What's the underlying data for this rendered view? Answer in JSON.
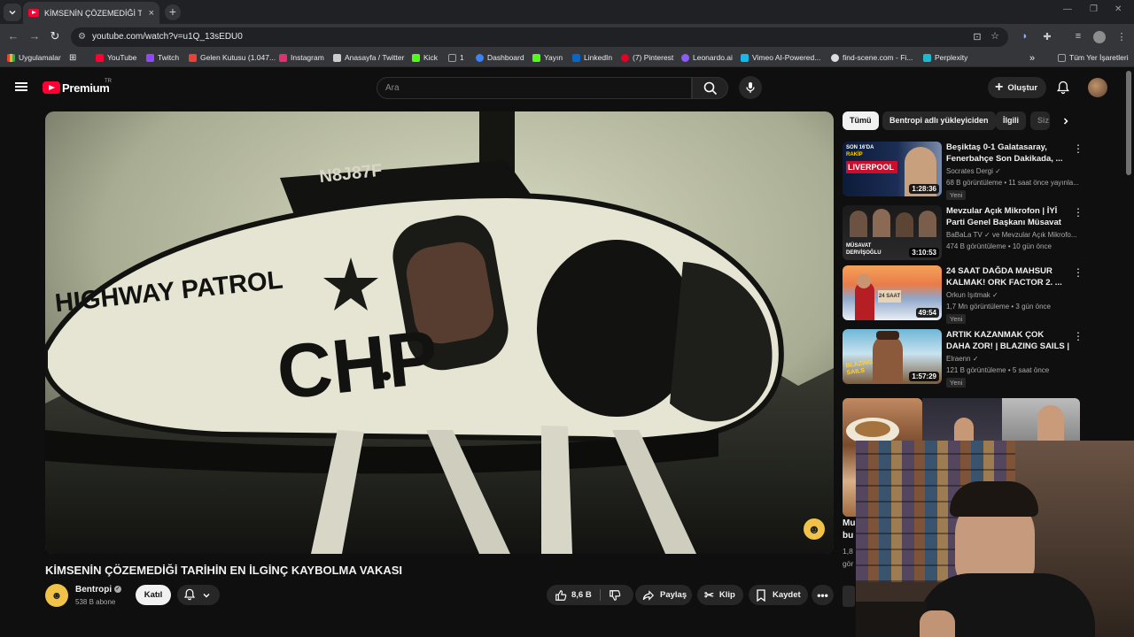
{
  "browser": {
    "tab_title": "KİMSENİN ÇÖZEMEDİĞİ TARİHİN EN İLGİNÇ KAYBOLMA VAKASI",
    "tab_close": "×",
    "new_tab": "+",
    "url": "youtube.com/watch?v=u1Q_13sEDU0"
  },
  "bookmarks": {
    "items": [
      {
        "label": "Uygulamalar",
        "color": "#e37400"
      },
      {
        "label": "YouTube",
        "color": "#ff0033"
      },
      {
        "label": "Twitch",
        "color": "#9146ff"
      },
      {
        "label": "Gelen Kutusu (1.047...",
        "color": "#ea4335"
      },
      {
        "label": "Instagram",
        "color": "#e1306c"
      },
      {
        "label": "Anasayfa / Twitter",
        "color": "#cccccc"
      },
      {
        "label": "Kick",
        "color": "#53fc18"
      },
      {
        "label": "1",
        "color": "#9aa0a6"
      },
      {
        "label": "Dashboard",
        "color": "#3b82f6"
      },
      {
        "label": "Yayın",
        "color": "#53fc18"
      },
      {
        "label": "LinkedIn",
        "color": "#0a66c2"
      },
      {
        "label": "(7) Pinterest",
        "color": "#e60023"
      },
      {
        "label": "Leonardo.ai",
        "color": "#8b5cf6"
      },
      {
        "label": "Vimeo AI-Powered...",
        "color": "#1ab7ea"
      },
      {
        "label": "find-scene.com - Fi...",
        "color": "#dddddd"
      },
      {
        "label": "Perplexity",
        "color": "#20b8cd"
      }
    ],
    "more": "»",
    "all_bookmarks": "Tüm Yer İşaretleri"
  },
  "youtube": {
    "logo": "Premium",
    "country": "TR",
    "search_placeholder": "Ara",
    "create_label": "Oluştur"
  },
  "video": {
    "title": "KİMSENİN ÇÖZEMEDİĞİ TARİHİN EN İLGİNÇ KAYBOLMA VAKASI",
    "frame_text": {
      "tail_number": "N8J87F",
      "patrol": "HIGHWAY PATROL",
      "chp": "CHP"
    },
    "channel": "Bentropi",
    "subscribers": "538 B abone",
    "join_label": "Katıl",
    "likes": "8,6 B",
    "share_label": "Paylaş",
    "clip_label": "Klip",
    "save_label": "Kaydet"
  },
  "chips": [
    "Tümü",
    "Bentropi adlı yükleyiciden",
    "İlgili",
    "Siz"
  ],
  "recommendations": [
    {
      "title": "Beşiktaş 0-1 Galatasaray, Fenerbahçe Son Dakikada, ...",
      "channel": "Socrates Dergi",
      "meta": "68 B görüntüleme • 11 saat önce yayınla...",
      "duration": "1:28:36",
      "badge": "Yeni",
      "thumb_text": "LIVERPOOL"
    },
    {
      "title": "Mevzular Açık Mikrofon | İYİ Parti Genel Başkanı Müsavat ...",
      "channel": "BaBaLa TV",
      "channel_extra": "ve Mevzular Açık Mikrofo...",
      "meta": "474 B görüntüleme • 10 gün önce",
      "duration": "3:10:53",
      "badge": "",
      "thumb_text": "MÜSAVAT DERVİŞOĞLU"
    },
    {
      "title": "24 SAAT DAĞDA MAHSUR KALMAK! ORK FACTOR 2. ...",
      "channel": "Orkun Işıtmak",
      "meta": "1,7 Mn görüntüleme • 3 gün önce",
      "duration": "49:54",
      "badge": "Yeni",
      "thumb_text": "24 SAAT"
    },
    {
      "title": "ARTIK KAZANMAK ÇOK DAHA ZOR! | BLAZING SAILS | BÖLÜ...",
      "channel": "Elraenn",
      "meta": "121 B görüntüleme • 5 saat önce",
      "duration": "1:57:29",
      "badge": "Yeni",
      "thumb_text": "BLAZING SAILS"
    }
  ],
  "partial_rec": {
    "title_line1": "Mu",
    "title_line2": "bu",
    "meta1": "1,8",
    "meta2": "gör"
  }
}
